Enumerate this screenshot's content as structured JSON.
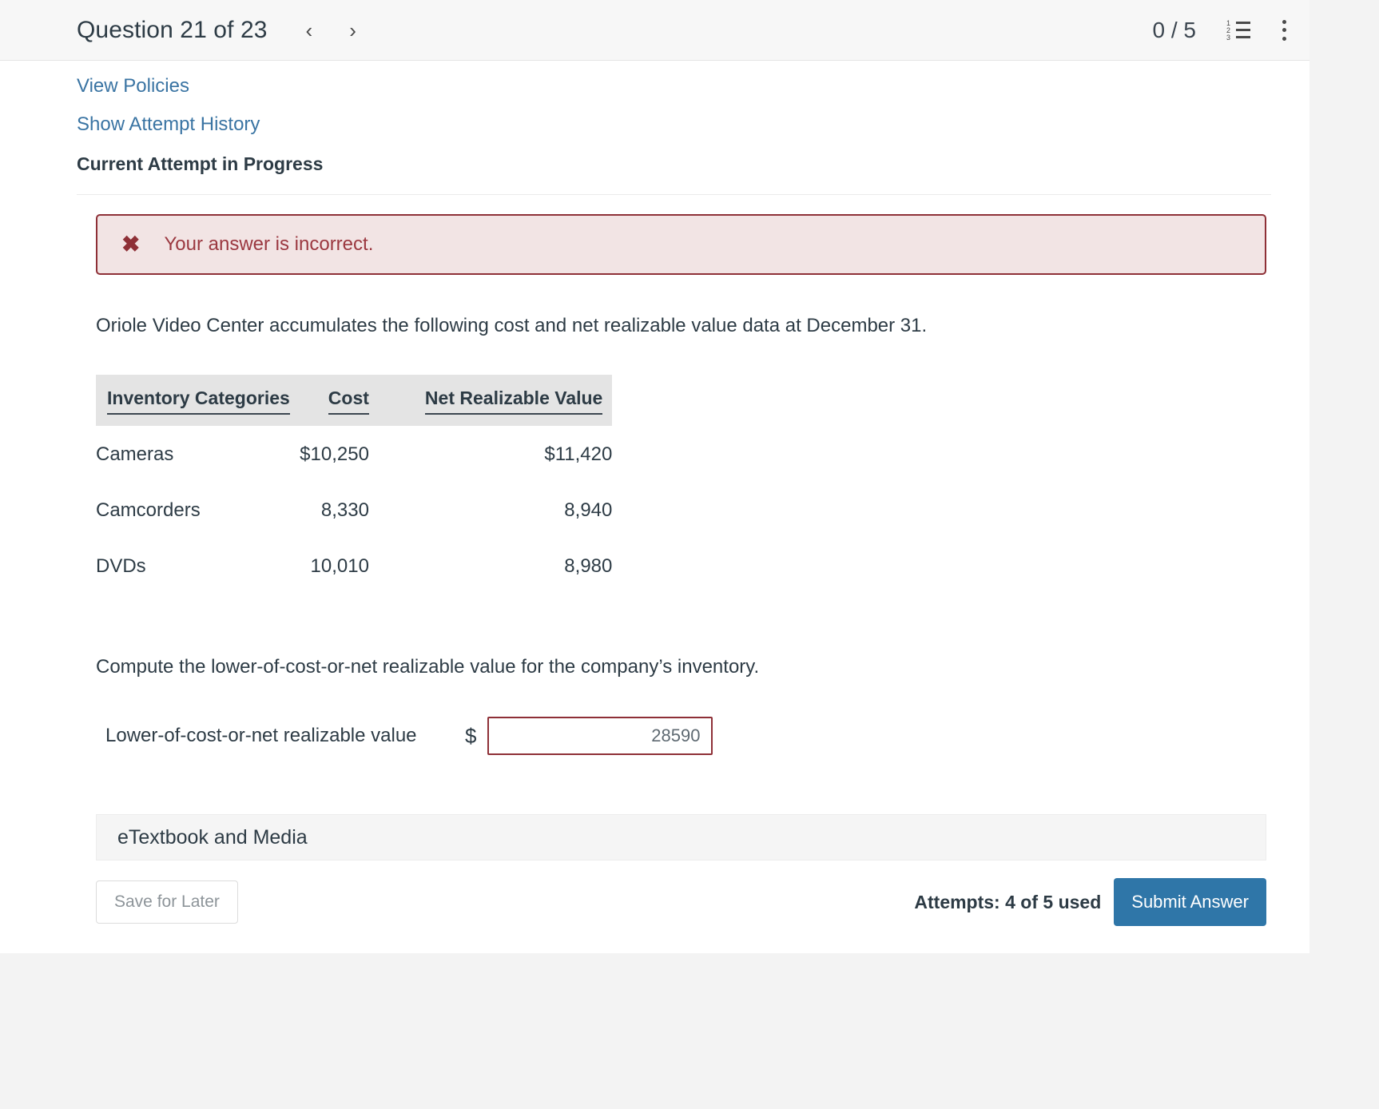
{
  "header": {
    "question_title": "Question 21 of 23",
    "prev_arrow": "‹",
    "next_arrow": "›",
    "score": "0 / 5",
    "list_digits": [
      "1",
      "2",
      "3"
    ]
  },
  "links": {
    "view_policies": "View Policies",
    "show_attempt_history": "Show Attempt History"
  },
  "attempt_section": {
    "heading": "Current Attempt in Progress"
  },
  "alert": {
    "icon": "✖",
    "message": "Your answer is incorrect.",
    "border_color": "#8e3037",
    "background_color": "#f2e4e4",
    "text_color": "#9b3840"
  },
  "question": {
    "intro": "Oriole Video Center accumulates the following cost and net realizable value data at December 31.",
    "instruction": "Compute the lower-of-cost-or-net realizable value for the company’s inventory."
  },
  "table": {
    "headers": [
      "Inventory Categories",
      "Cost",
      "Net Realizable Value"
    ],
    "rows": [
      {
        "category": "Cameras",
        "cost": "$10,250",
        "nrv": "$11,420"
      },
      {
        "category": "Camcorders",
        "cost": "8,330",
        "nrv": "8,940"
      },
      {
        "category": "DVDs",
        "cost": "10,010",
        "nrv": "8,980"
      }
    ]
  },
  "answer": {
    "label": "Lower-of-cost-or-net realizable value",
    "currency_symbol": "$",
    "value": "28590",
    "placeholder": ""
  },
  "etextbook": {
    "label": "eTextbook and Media"
  },
  "footer": {
    "save_label": "Save for Later",
    "attempts_text": "Attempts: 4 of 5 used",
    "submit_label": "Submit Answer",
    "submit_color": "#2f76a8"
  }
}
